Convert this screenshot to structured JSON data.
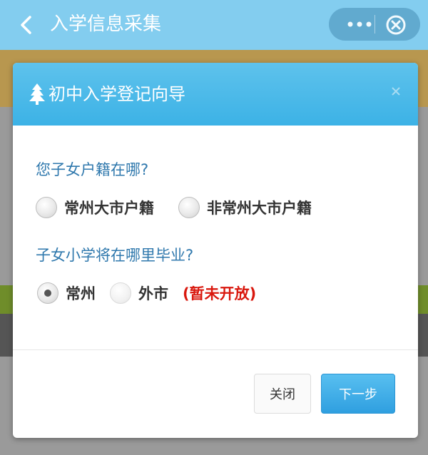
{
  "app_bar": {
    "title": "入学信息采集",
    "back_icon": "chevron-left-icon",
    "more_icon": "more-dots-icon",
    "close_icon": "circle-close-icon"
  },
  "modal": {
    "title": "初中入学登记向导",
    "title_icon": "tree-icon",
    "close_icon": "close-x-icon",
    "question1": "您子女户籍在哪?",
    "q1_options": [
      "常州大市户籍",
      "非常州大市户籍"
    ],
    "question2": "子女小学将在哪里毕业?",
    "q2_options": [
      "常州",
      "外市"
    ],
    "q2_note": "(暂未开放)",
    "buttons": {
      "close": "关闭",
      "next": "下一步"
    }
  },
  "colors": {
    "app_bar": "#83cdef",
    "modal_header": "#3cb2e6",
    "question_text": "#2f78ad",
    "note_text": "#d9180e",
    "primary_button": "#2f9fe0"
  }
}
